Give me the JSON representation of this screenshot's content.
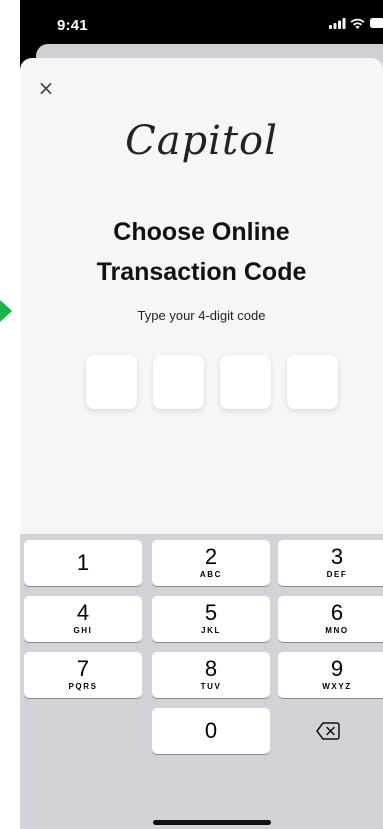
{
  "status_bar": {
    "time": "9:41"
  },
  "sheet": {
    "close_label": "×",
    "logo": "Capitol",
    "title_line1": "Choose Online",
    "title_line2": "Transaction Code",
    "subtitle": "Type your 4-digit code",
    "code_length": 4
  },
  "keyboard": {
    "keys": [
      {
        "num": "1",
        "letters": ""
      },
      {
        "num": "2",
        "letters": "ABC"
      },
      {
        "num": "3",
        "letters": "DEF"
      },
      {
        "num": "4",
        "letters": "GHI"
      },
      {
        "num": "5",
        "letters": "JKL"
      },
      {
        "num": "6",
        "letters": "MNO"
      },
      {
        "num": "7",
        "letters": "PQRS"
      },
      {
        "num": "8",
        "letters": "TUV"
      },
      {
        "num": "9",
        "letters": "WXYZ"
      },
      {
        "num": "0",
        "letters": ""
      }
    ],
    "delete_icon": "backspace-icon"
  },
  "colors": {
    "sheet_bg": "#f6f6f7",
    "keyboard_bg": "#d1d3d9",
    "arrow_green": "#1ab24a"
  }
}
